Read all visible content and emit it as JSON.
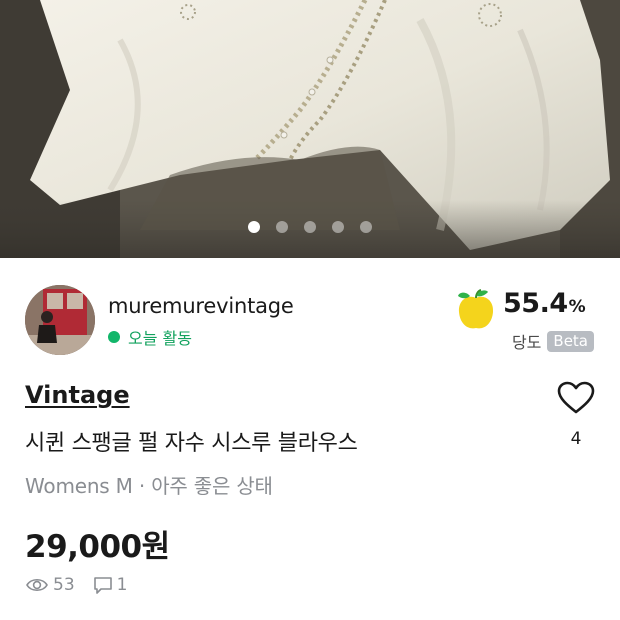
{
  "gallery": {
    "total_images": 5,
    "active_index": 0
  },
  "seller": {
    "username": "muremurevintage",
    "status": "오늘 활동",
    "status_color": "#12b66a",
    "rating_value": "55.4",
    "rating_unit": "%",
    "rating_label": "당도",
    "rating_badge": "Beta"
  },
  "product": {
    "category": "Vintage",
    "title": "시퀸 스팽글 펄 자수 시스루 블라우스",
    "meta": "Womens M · 아주 좋은 상태",
    "price": "29,000원",
    "views": "53",
    "comments": "1",
    "likes": "4"
  },
  "icons": {
    "like": "heart-icon",
    "views": "eye-icon",
    "comments": "chat-icon",
    "rating": "apple-icon"
  }
}
